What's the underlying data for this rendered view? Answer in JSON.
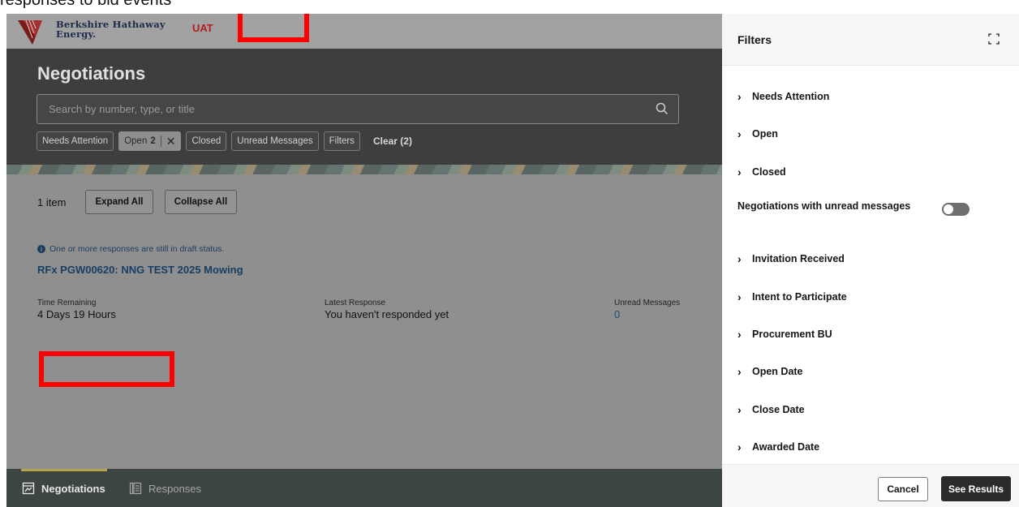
{
  "caption": "responses to bid events",
  "header": {
    "logo_line1": "Berkshire Hathaway",
    "logo_line2": "Energy.",
    "env_label": "UAT"
  },
  "hero": {
    "title": "Negotiations",
    "search_placeholder": "Search by number, type, or title",
    "chips": {
      "needs_attention": "Needs Attention",
      "open": "Open",
      "open_count": "2",
      "closed": "Closed",
      "unread_messages": "Unread Messages",
      "filters": "Filters",
      "clear": "Clear (2)"
    }
  },
  "results": {
    "item_count": "1 item",
    "expand_all": "Expand All",
    "collapse_all": "Collapse All",
    "notice": "One or more responses are still in draft status.",
    "rfx_title": "RFx PGW00620: NNG TEST 2025 Mowing",
    "time_remaining_label": "Time Remaining",
    "time_remaining_value": "4 Days 19 Hours",
    "latest_response_label": "Latest Response",
    "latest_response_value": "You haven't responded yet",
    "unread_label": "Unread Messages",
    "unread_value": "0"
  },
  "bottom_nav": {
    "negotiations": "Negotiations",
    "responses": "Responses"
  },
  "filters_panel": {
    "title": "Filters",
    "items": {
      "needs_attention": "Needs Attention",
      "open": "Open",
      "closed": "Closed",
      "invitation_received": "Invitation Received",
      "intent_to_participate": "Intent to Participate",
      "procurement_bu": "Procurement BU",
      "open_date": "Open Date",
      "close_date": "Close Date",
      "awarded_date": "Awarded Date"
    },
    "toggle_label": "Negotiations with unread messages",
    "toggle_on": false,
    "cancel": "Cancel",
    "see_results": "See Results"
  },
  "colors": {
    "highlight_box": "#ff0000",
    "env_label": "#b71c1c",
    "link": "#183f63"
  }
}
